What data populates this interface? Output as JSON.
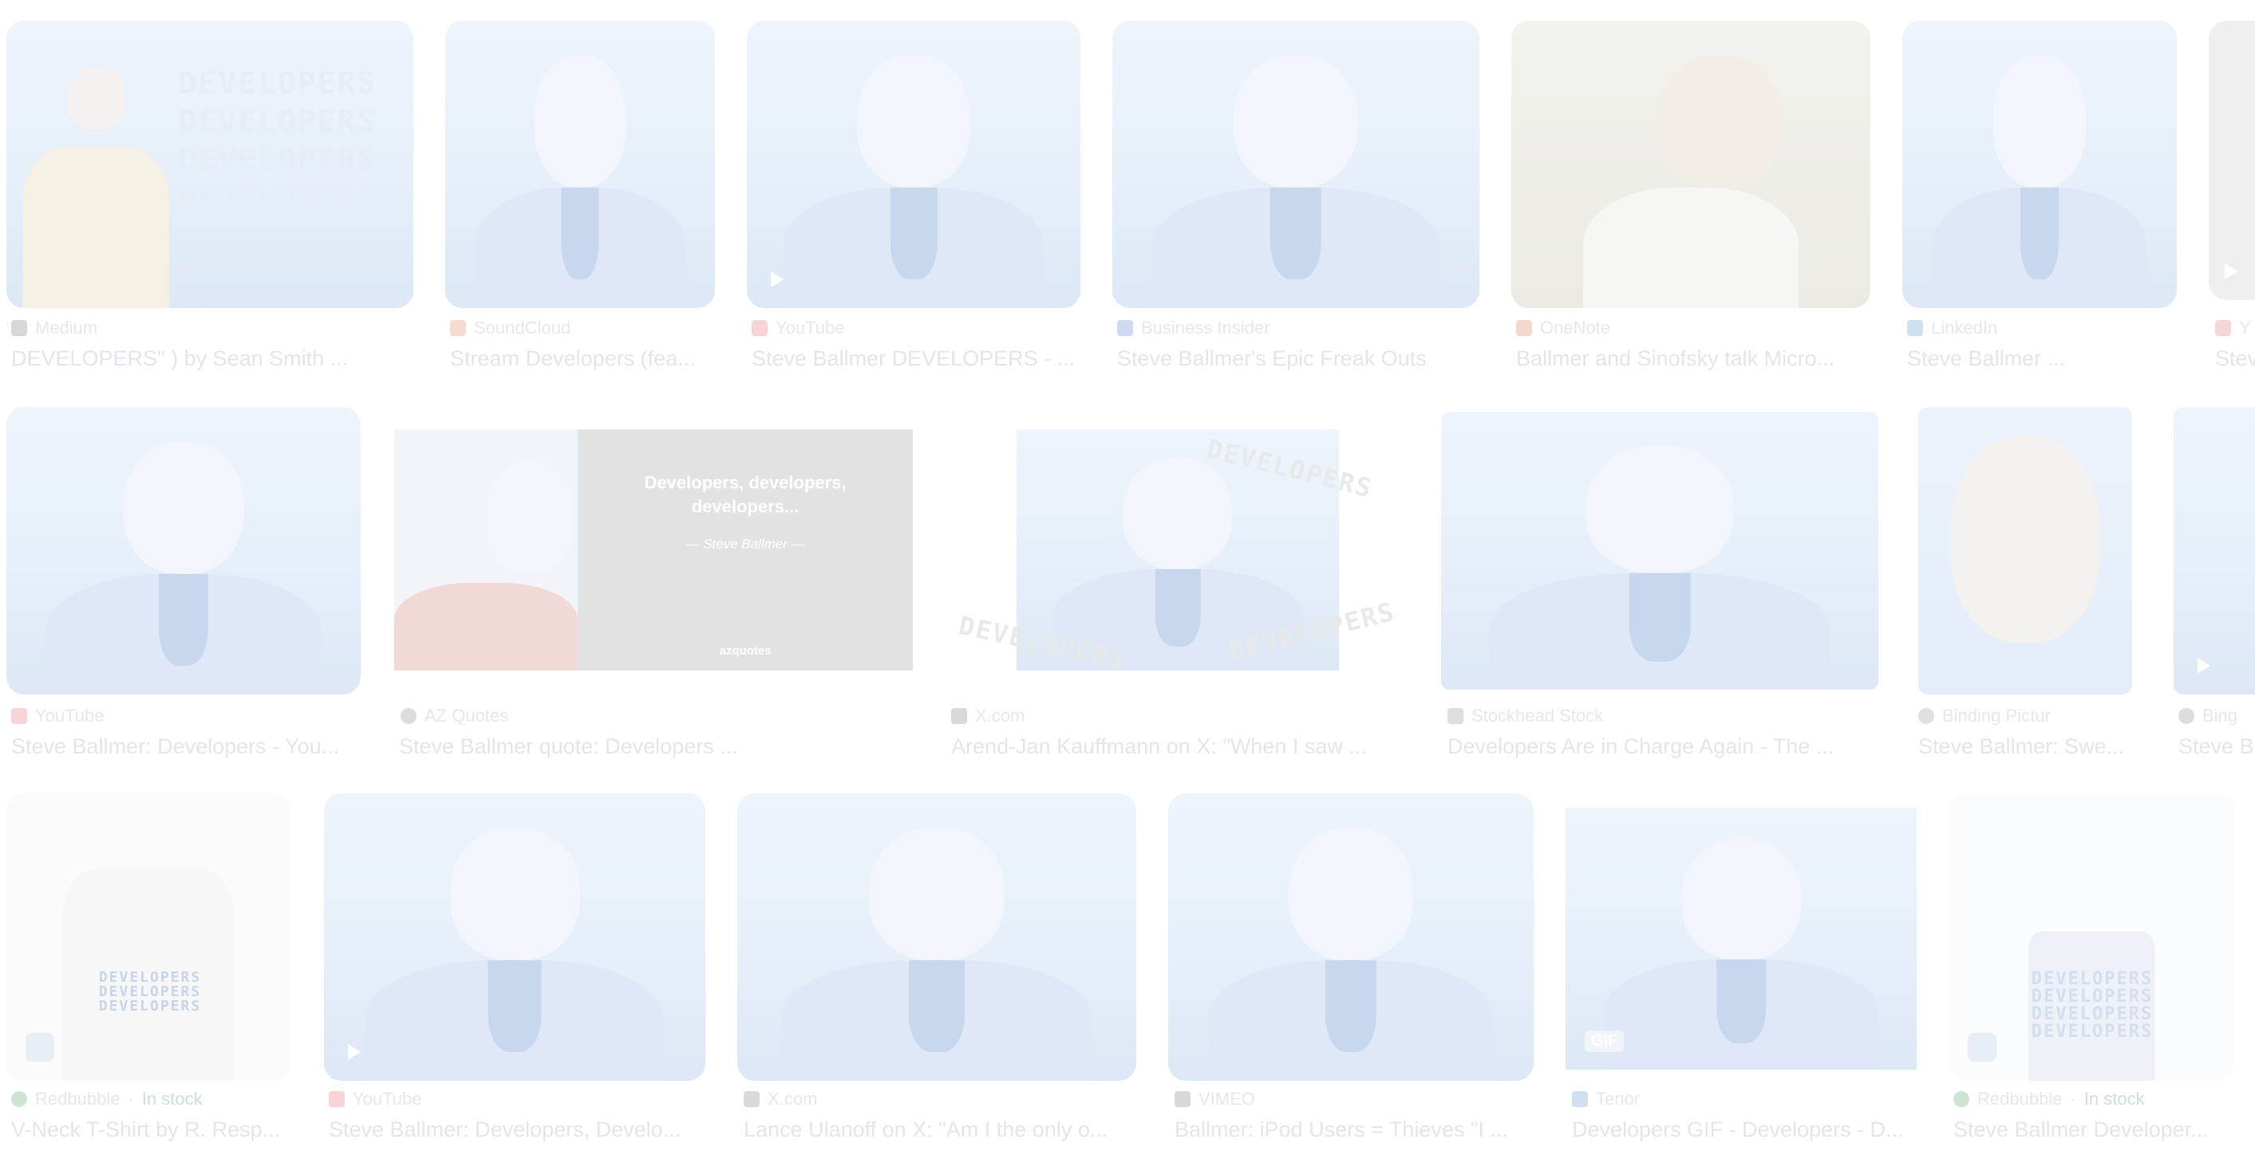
{
  "colors": {
    "youtube": "#f5d5d5",
    "soundcloud": "#f6dccf",
    "medium": "#d7d7d7",
    "business_insider": "#cfd9f0",
    "linkedin": "#cfe0f0",
    "x": "#d9d9d9",
    "azquotes": "#dddddd",
    "stock": "#dedede",
    "shopify": "#cfe3d3",
    "vimeo": "#d8d8d8",
    "tenor": "#cfe0f2"
  },
  "results": [
    {
      "source": "Medium",
      "title": "DEVELOPERS\" ) by Sean Smith ...",
      "overlay": [
        "DEVELOPERS",
        "DEVELOPERS",
        "DEVELOPERS",
        "DEVELOPERS"
      ],
      "icon": "medium-icon"
    },
    {
      "source": "SoundCloud",
      "title": "Stream Developers (fea...",
      "icon": "soundcloud-icon"
    },
    {
      "source": "YouTube",
      "title": "Steve Ballmer DEVELOPERS - ...",
      "icon": "youtube-icon"
    },
    {
      "source": "Business Insider",
      "title": "Steve Ballmer's Epic Freak Outs",
      "icon": "business-insider-icon"
    },
    {
      "source": "OneNote",
      "title": "Ballmer and Sinofsky talk Micro...",
      "icon": "onenote-icon"
    },
    {
      "source": "LinkedIn",
      "title": "Steve Ballmer ...",
      "icon": "linkedin-icon"
    },
    {
      "source": "Y",
      "title": "Stev",
      "icon": "youtube-icon"
    },
    {
      "source": "YouTube",
      "title": "Steve Ballmer: Developers - You...",
      "icon": "youtube-icon"
    },
    {
      "source": "AZ Quotes",
      "title": "Steve Ballmer quote: Developers ...",
      "quote": "Developers, developers, developers...",
      "quote_author": "— Steve Ballmer —",
      "quote_brand": "azquotes",
      "icon": "azquotes-icon"
    },
    {
      "source": "X.com",
      "title": "Arend-Jan Kauffmann on X: \"When I saw ...",
      "overlay": [
        "DEVELOPERS",
        "DEVELOPERS",
        "DEVELOPERS"
      ],
      "icon": "x-icon"
    },
    {
      "source": "Stockhead Stock",
      "title": "Developers Are in Charge Again - The ...",
      "icon": "stock-icon"
    },
    {
      "source": "Binding Pictur",
      "title": "Steve Ballmer: Swe...",
      "icon": "binding-icon"
    },
    {
      "source": "Bing",
      "title": "Steve B",
      "icon": "bing-icon"
    },
    {
      "source": "Redbubble",
      "source_extra": "In stock",
      "title": "V-Neck T-Shirt by R. Resp...",
      "overlay": [
        "DEVELOPERS",
        "DEVELOPERS",
        "DEVELOPERS"
      ],
      "icon": "redbubble-icon"
    },
    {
      "source": "YouTube",
      "title": "Steve Ballmer: Developers, Develo...",
      "icon": "youtube-icon"
    },
    {
      "source": "X.com",
      "title": "Lance Ulanoff on X: \"Am I the only o...",
      "icon": "x-icon"
    },
    {
      "source": "VIMEO",
      "title": "Ballmer: iPod Users = Thieves \"I ...",
      "icon": "vimeo-icon"
    },
    {
      "source": "Tenor",
      "title": "Developers GIF - Developers - D...",
      "badge": "GIF",
      "icon": "tenor-icon"
    },
    {
      "source": "Redbubble",
      "source_extra": "In stock",
      "title": "Steve Ballmer Developer...",
      "overlay": [
        "DEVELOPERS",
        "DEVELOPERS",
        "DEVELOPERS",
        "DEVELOPERS"
      ],
      "icon": "redbubble-icon"
    }
  ]
}
